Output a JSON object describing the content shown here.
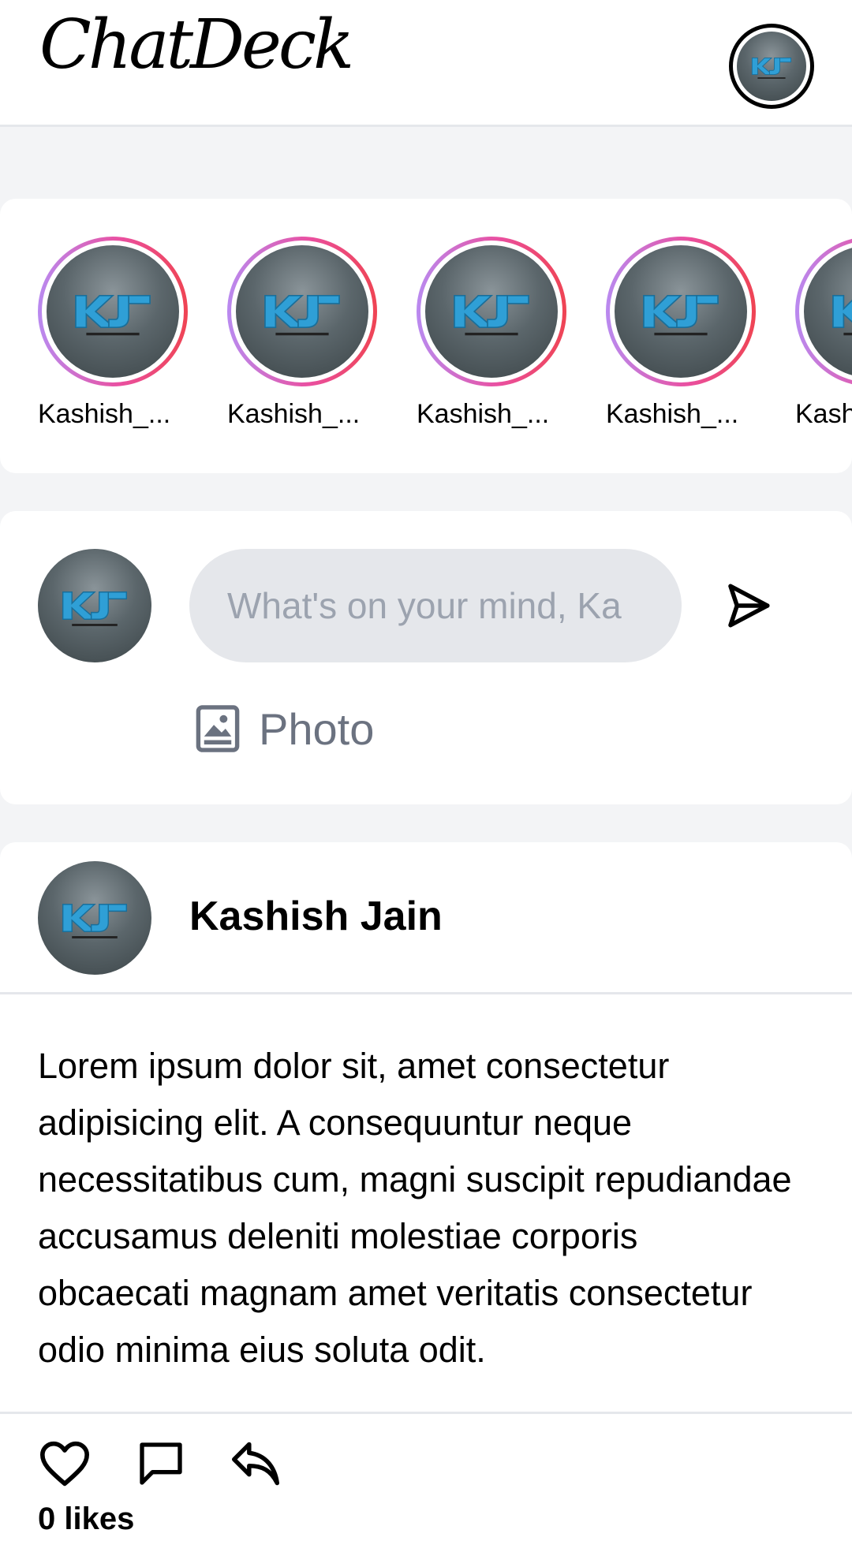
{
  "header": {
    "logo_text": "ChatDeck",
    "profile_avatar_icon": "kj-avatar"
  },
  "stories": {
    "items": [
      {
        "label": "Kashish_..."
      },
      {
        "label": "Kashish_..."
      },
      {
        "label": "Kashish_..."
      },
      {
        "label": "Kashish_..."
      },
      {
        "label": "Kash"
      }
    ],
    "ring_gradient": [
      "#b98af0",
      "#ea4fa0",
      "#ef4453"
    ]
  },
  "composer": {
    "placeholder": "What's on your mind, Ka",
    "value": "",
    "photo_label": "Photo",
    "send_icon": "send-icon",
    "photo_icon": "photo-icon"
  },
  "post": {
    "author": "Kashish Jain",
    "body": "Lorem ipsum dolor sit, amet consectetur adipisicing elit. A consequuntur neque necessitatibus cum, magni suscipit repudiandae accusamus deleniti molestiae corporis obcaecati magnam amet veritatis consectetur odio minima eius soluta odit.",
    "actions": [
      "heart-icon",
      "comment-icon",
      "share-icon"
    ],
    "likes_text": "0 likes"
  },
  "colors": {
    "page_background": "#f3f4f6",
    "card_background": "#ffffff",
    "input_background": "#e5e7eb",
    "muted_text": "#6b7280",
    "avatar_letters": "#2f9fd6"
  }
}
